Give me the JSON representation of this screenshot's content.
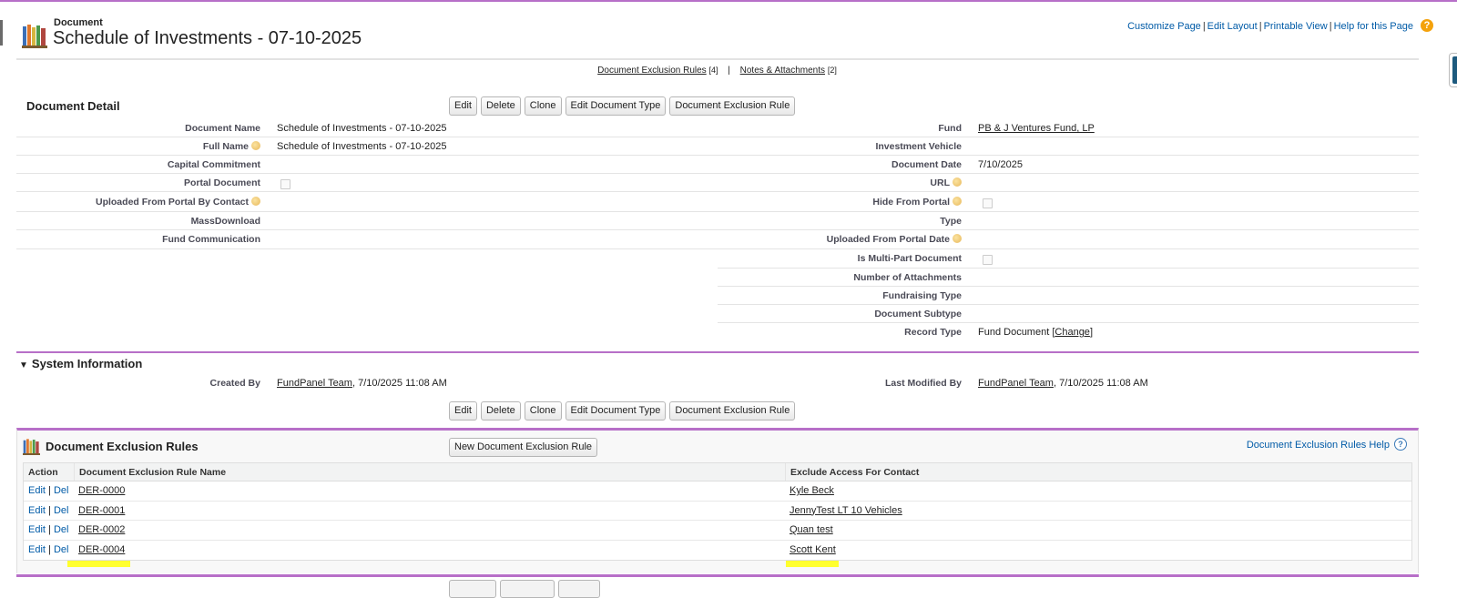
{
  "header": {
    "object_type": "Document",
    "title": "Schedule of Investments - 07-10-2025",
    "links": [
      "Customize Page",
      "Edit Layout",
      "Printable View",
      "Help for this Page"
    ],
    "help_icon": "?"
  },
  "related_links": {
    "items": [
      {
        "label": "Document Exclusion Rules",
        "count": "[4]"
      },
      {
        "label": "Notes & Attachments",
        "count": "[2]"
      }
    ],
    "separator": "|"
  },
  "detail": {
    "title": "Document Detail",
    "buttons": [
      "Edit",
      "Delete",
      "Clone",
      "Edit Document Type",
      "Document Exclusion Rule"
    ],
    "left": {
      "document_name_label": "Document Name",
      "document_name": "Schedule of Investments - 07-10-2025",
      "full_name_label": "Full Name",
      "full_name": "Schedule of Investments - 07-10-2025",
      "capital_commitment_label": "Capital Commitment",
      "portal_document_label": "Portal Document",
      "uploaded_by_contact_label": "Uploaded From Portal By Contact",
      "mass_download_label": "MassDownload",
      "fund_communication_label": "Fund Communication"
    },
    "right": {
      "fund_label": "Fund",
      "fund": "PB & J Ventures Fund, LP",
      "investment_vehicle_label": "Investment Vehicle",
      "document_date_label": "Document Date",
      "document_date": "7/10/2025",
      "url_label": "URL",
      "hide_from_portal_label": "Hide From Portal",
      "type_label": "Type",
      "uploaded_portal_date_label": "Uploaded From Portal Date",
      "multi_part_label": "Is Multi-Part Document",
      "num_attachments_label": "Number of Attachments",
      "fundraising_type_label": "Fundraising Type",
      "subtype_label": "Document Subtype",
      "record_type_label": "Record Type",
      "record_type": "Fund Document",
      "record_type_change": "Change"
    }
  },
  "system_info": {
    "title": "System Information",
    "created_by_label": "Created By",
    "created_by_user": "FundPanel Team",
    "created_by_date": ", 7/10/2025 11:08 AM",
    "modified_by_label": "Last Modified By",
    "modified_by_user": "FundPanel Team",
    "modified_by_date": ", 7/10/2025 11:08 AM"
  },
  "exclusion_rules": {
    "title": "Document Exclusion Rules",
    "new_button": "New Document Exclusion Rule",
    "help_link": "Document Exclusion Rules Help",
    "columns": [
      "Action",
      "Document Exclusion Rule Name",
      "Exclude Access For Contact"
    ],
    "rows": [
      {
        "edit": "Edit",
        "del": "Del",
        "name": "DER-0000",
        "contact": "Kyle Beck"
      },
      {
        "edit": "Edit",
        "del": "Del",
        "name": "DER-0001",
        "contact": "JennyTest LT 10 Vehicles"
      },
      {
        "edit": "Edit",
        "del": "Del",
        "name": "DER-0002",
        "contact": "Quan test"
      },
      {
        "edit": "Edit",
        "del": "Del",
        "name": "DER-0004",
        "contact": "Scott Kent"
      }
    ]
  },
  "colors": {
    "accent": "#b76fc8",
    "link": "#015ba7",
    "highlight": "#ffff00",
    "help_orange": "#f4a20c"
  }
}
